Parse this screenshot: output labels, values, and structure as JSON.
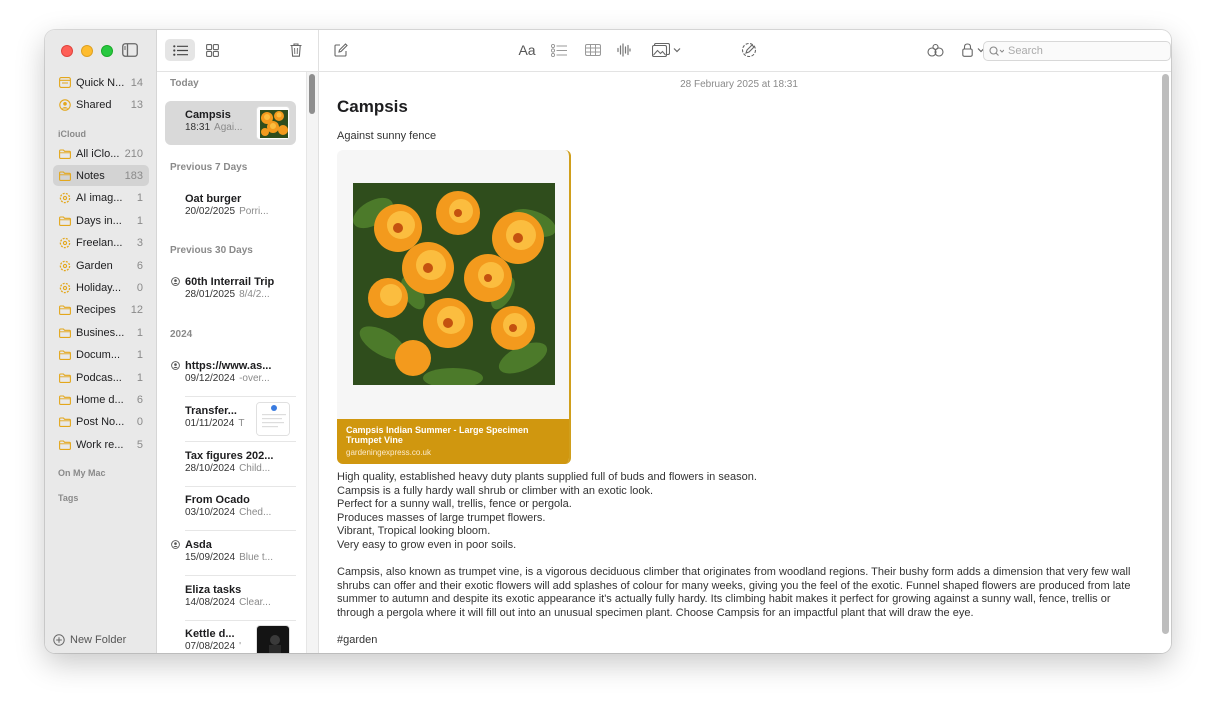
{
  "sidebar": {
    "pinned": [
      {
        "label": "Quick N...",
        "count": "14",
        "icon": "note-folder-icon"
      },
      {
        "label": "Shared",
        "count": "13",
        "icon": "shared-icon"
      }
    ],
    "icloud_header": "iCloud",
    "folders": [
      {
        "label": "All iClo...",
        "count": "210",
        "icon": "folder-icon"
      },
      {
        "label": "Notes",
        "count": "183",
        "icon": "folder-icon",
        "active": true
      },
      {
        "label": "AI imag...",
        "count": "1",
        "icon": "smart-folder-icon"
      },
      {
        "label": "Days in...",
        "count": "1",
        "icon": "folder-icon"
      },
      {
        "label": "Freelan...",
        "count": "3",
        "icon": "smart-folder-icon"
      },
      {
        "label": "Garden",
        "count": "6",
        "icon": "smart-folder-icon"
      },
      {
        "label": "Holiday...",
        "count": "0",
        "icon": "smart-folder-icon"
      },
      {
        "label": "Recipes",
        "count": "12",
        "icon": "folder-icon"
      },
      {
        "label": "Busines...",
        "count": "1",
        "icon": "folder-icon"
      },
      {
        "label": "Docum...",
        "count": "1",
        "icon": "folder-icon"
      },
      {
        "label": "Podcas...",
        "count": "1",
        "icon": "folder-icon"
      },
      {
        "label": "Home d...",
        "count": "6",
        "icon": "folder-icon"
      },
      {
        "label": "Post No...",
        "count": "0",
        "icon": "folder-icon"
      },
      {
        "label": "Work re...",
        "count": "5",
        "icon": "folder-icon"
      }
    ],
    "on_my_mac_header": "On My Mac",
    "tags_header": "Tags",
    "new_folder_label": "New Folder"
  },
  "notelist": {
    "groups": [
      {
        "header": "Today",
        "notes": [
          {
            "title": "Campsis",
            "date": "18:31",
            "preview": "Agai...",
            "thumb": "flower",
            "selected": true
          }
        ]
      },
      {
        "header": "Previous 7 Days",
        "notes": [
          {
            "title": "Oat burger",
            "date": "20/02/2025",
            "preview": "Porri..."
          }
        ]
      },
      {
        "header": "Previous 30 Days",
        "notes": [
          {
            "title": "60th Interrail Trip",
            "date": "28/01/2025",
            "preview": "8/4/2...",
            "shared": true
          }
        ]
      },
      {
        "header": "2024",
        "notes": [
          {
            "title": "https://www.as...",
            "date": "09/12/2024",
            "preview": "-over...",
            "shared": true
          },
          {
            "title": "Transfer...",
            "date": "01/11/2024",
            "preview": "T",
            "thumb": "doc"
          },
          {
            "title": "Tax figures 202...",
            "date": "28/10/2024",
            "preview": "Child..."
          },
          {
            "title": "From Ocado",
            "date": "03/10/2024",
            "preview": "Ched..."
          },
          {
            "title": "Asda",
            "date": "15/09/2024",
            "preview": "Blue t...",
            "shared": true
          },
          {
            "title": "Eliza tasks",
            "date": "14/08/2024",
            "preview": "Clear..."
          },
          {
            "title": "Kettle d...",
            "date": "07/08/2024",
            "preview": "'",
            "thumb": "dark"
          }
        ]
      }
    ]
  },
  "editor": {
    "search_placeholder": "Search",
    "format_label": "Aa",
    "date": "28 February 2025 at 18:31",
    "title": "Campsis",
    "subtitle": "Against sunny fence",
    "link_card": {
      "title": "Campsis Indian Summer - Large Specimen Trumpet Vine",
      "site": "gardeningexpress.co.uk",
      "accent": "#d0970f"
    },
    "body_lines": [
      "High quality, established heavy duty plants supplied full of buds and flowers in season.",
      "Campsis is a fully hardy wall shrub or climber with an exotic look.",
      "Perfect for a sunny wall, trellis, fence or pergola.",
      "Produces masses of large trumpet flowers.",
      "Vibrant, Tropical looking bloom.",
      "Very easy to grow even in poor soils."
    ],
    "paragraph": "Campsis, also known as trumpet vine, is a vigorous deciduous climber that originates from woodland regions. Their bushy form adds a dimension that very few wall shrubs can offer and their exotic flowers will add splashes of colour for many weeks, giving you the feel of the exotic. Funnel shaped flowers are produced from late summer to autumn and despite its exotic appearance it's actually fully hardy. Its climbing habit makes it perfect for growing against a sunny wall, fence, trellis or through a pergola where it will fill out into an unusual specimen plant. Choose Campsis for an impactful plant that will draw the eye.",
    "tag": "#garden"
  },
  "colors": {
    "folder_accent": "#e3a71c",
    "selection": "#d9d9d9"
  }
}
